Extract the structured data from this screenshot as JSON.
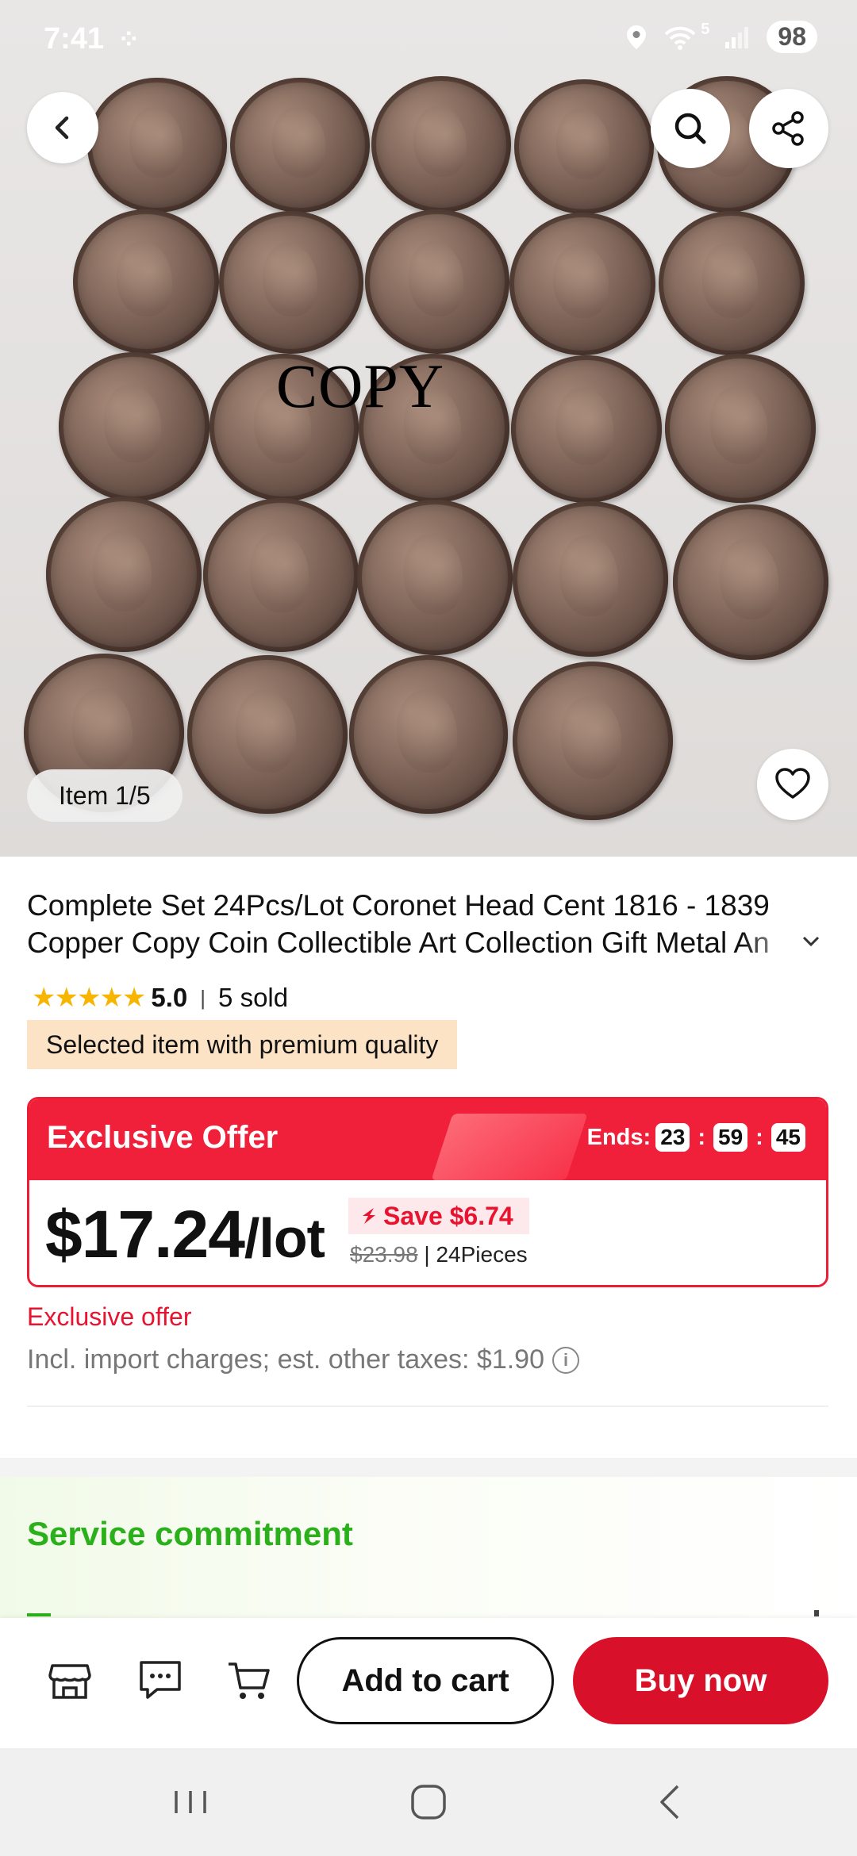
{
  "status_bar": {
    "time": "7:41",
    "signal_label": "5",
    "battery": "98"
  },
  "hero": {
    "watermark_text": "COPY",
    "item_counter": "Item 1/5"
  },
  "product": {
    "title_line1": "Complete Set 24Pcs/Lot Coronet Head Cent 1816 - 1839",
    "title_line2": "Copper Copy Coin Collectible Art Collection Gift Metal An",
    "rating": "5.0",
    "sold": "5 sold",
    "premium_badge": "Selected item with premium quality"
  },
  "offer": {
    "title": "Exclusive Offer",
    "ends_label": "Ends:",
    "timer": {
      "hours": "23",
      "minutes": "59",
      "seconds": "45"
    },
    "price": "$17.24",
    "price_unit": "/lot",
    "save": "Save $6.74",
    "original_price": "$23.98",
    "pieces": "24Pieces",
    "exclusive_note": "Exclusive offer",
    "tax_note": "Incl. import charges; est. other taxes: $1.90"
  },
  "service": {
    "title": "Service commitment"
  },
  "actions": {
    "add_to_cart": "Add to cart",
    "buy_now": "Buy now"
  },
  "colors": {
    "accent_red": "#f01f3a",
    "buy_red": "#d8102a",
    "star": "#f7b500",
    "service_green": "#2bb01c",
    "premium_bg": "#fde3c6"
  },
  "icons": [
    "back-arrow-icon",
    "search-icon",
    "share-icon",
    "heart-icon",
    "store-icon",
    "chat-icon",
    "cart-icon",
    "info-icon",
    "chevron-down-icon"
  ]
}
